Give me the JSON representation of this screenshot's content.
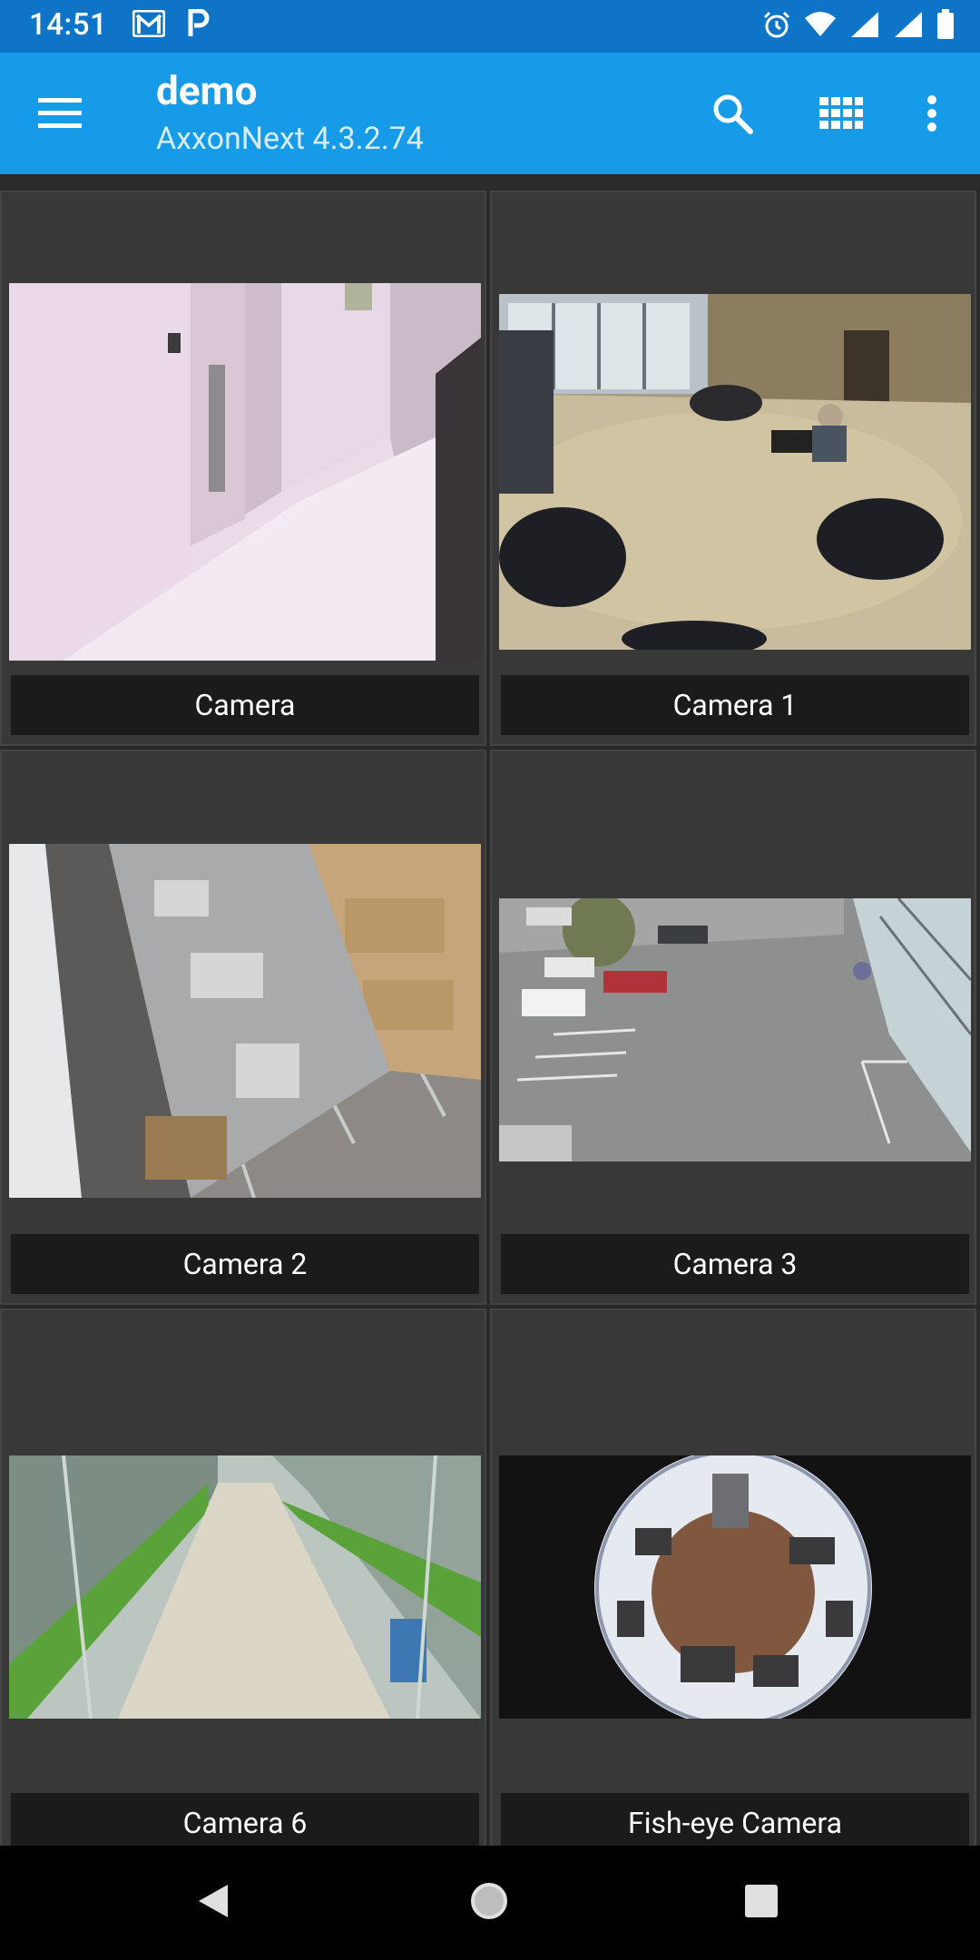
{
  "status_bar": {
    "time": "14:51",
    "left_icons": [
      "gmail-icon",
      "parking-icon"
    ],
    "right_icons": [
      "alarm-icon",
      "wifi-icon",
      "signal-icon",
      "signal-icon",
      "battery-icon"
    ]
  },
  "app_bar": {
    "title": "demo",
    "subtitle": "AxxonNext 4.3.2.74",
    "actions": [
      "search-icon",
      "grid-view-icon",
      "more-vert-icon"
    ]
  },
  "cameras": [
    {
      "label": "Camera"
    },
    {
      "label": "Camera 1"
    },
    {
      "label": "Camera 2"
    },
    {
      "label": "Camera 3"
    },
    {
      "label": "Camera 6"
    },
    {
      "label": "Fish-eye Camera"
    }
  ],
  "nav_bar": {
    "buttons": [
      "back-icon",
      "home-icon",
      "recents-icon"
    ]
  },
  "colors": {
    "status_bar": "#0d74c8",
    "app_bar": "#169be9",
    "tile_bg": "#383838",
    "label_bg": "#1b1b1b"
  }
}
